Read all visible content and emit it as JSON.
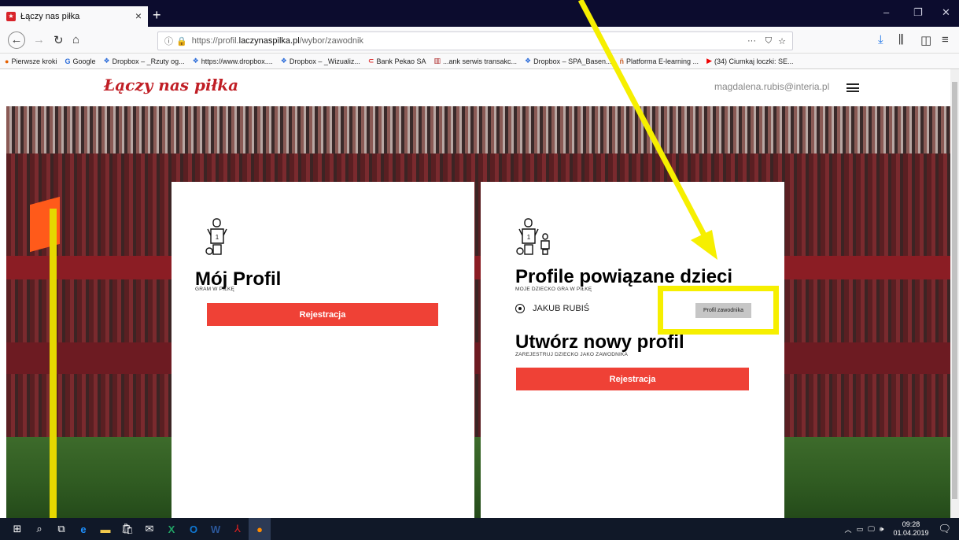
{
  "browser": {
    "tab_title": "Łączy nas piłka",
    "url_prefix": "https://profil.",
    "url_domain": "laczynaspilka.pl",
    "url_path": "/wybor/zawodnik",
    "bookmarks": [
      "Pierwsze kroki",
      "Google",
      "Dropbox – _Rzuty og...",
      "https://www.dropbox....",
      "Dropbox – _Wizualiz...",
      "Bank Pekao SA",
      "...ank serwis transakc...",
      "Dropbox – SPA_Basen...",
      "Platforma E-learning ...",
      "(34) Ciumkaj loczki: SE..."
    ]
  },
  "site": {
    "logo": "Łączy nas piłka",
    "user_email": "magdalena.rubis@interia.pl"
  },
  "left_card": {
    "title": "Mój Profil",
    "subtitle": "GRAM W PIŁKĘ",
    "button": "Rejestracja"
  },
  "right_card": {
    "title": "Profile powiązane dzieci",
    "subtitle": "MOJE DZIECKO GRA W PIŁKĘ",
    "child_name": "JAKUB RUBIŚ",
    "child_button": "Profil zawodnika",
    "new_title": "Utwórz nowy profil",
    "new_subtitle": "ZAREJESTRUJ DZIECKO JAKO ZAWODNIKA",
    "button": "Rejestracja"
  },
  "taskbar": {
    "time": "09:28",
    "date": "01.04.2019"
  },
  "colors": {
    "brand_red": "#c01e25",
    "button_red": "#ef4136",
    "highlight_yellow": "#f6ef00"
  }
}
